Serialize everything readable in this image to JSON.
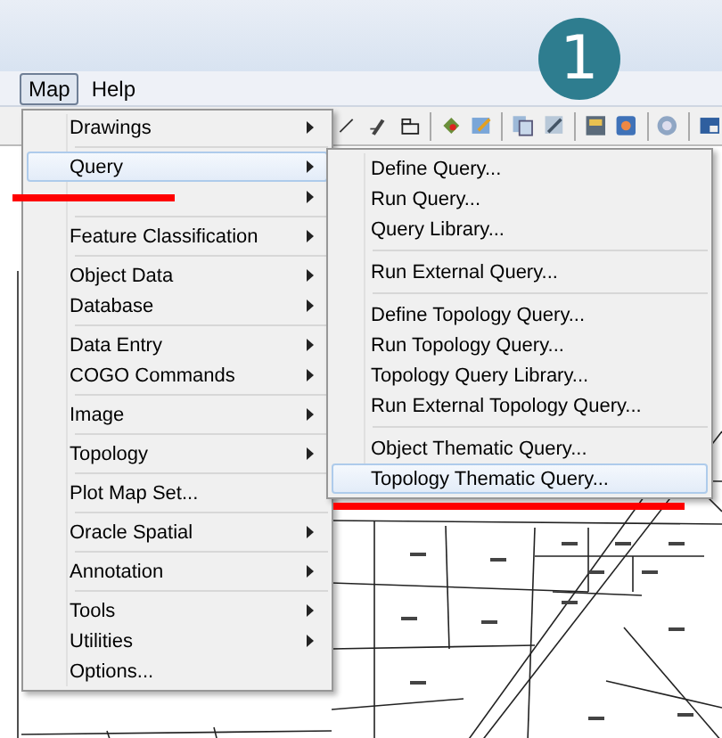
{
  "badge": "1",
  "menubar": [
    {
      "label": "Map",
      "selected": true
    },
    {
      "label": "Help",
      "selected": false
    }
  ],
  "menu": {
    "items": [
      {
        "kind": "item",
        "label": "Drawings",
        "submenu": true,
        "selected": false
      },
      {
        "kind": "separator"
      },
      {
        "kind": "item",
        "label": "Query",
        "submenu": true,
        "selected": true
      },
      {
        "kind": "item",
        "submenu": true,
        "selected": false,
        "struck": true
      },
      {
        "kind": "separator"
      },
      {
        "kind": "item",
        "label": "Feature Classification",
        "submenu": true,
        "selected": false
      },
      {
        "kind": "separator"
      },
      {
        "kind": "item",
        "label": "Object Data",
        "submenu": true,
        "selected": false
      },
      {
        "kind": "item",
        "label": "Database",
        "submenu": true,
        "selected": false
      },
      {
        "kind": "separator"
      },
      {
        "kind": "item",
        "label": "Data Entry",
        "submenu": true,
        "selected": false
      },
      {
        "kind": "item",
        "label": "COGO Commands",
        "submenu": true,
        "selected": false
      },
      {
        "kind": "separator"
      },
      {
        "kind": "item",
        "label": "Image",
        "submenu": true,
        "selected": false
      },
      {
        "kind": "separator"
      },
      {
        "kind": "item",
        "label": "Topology",
        "submenu": true,
        "selected": false
      },
      {
        "kind": "separator"
      },
      {
        "kind": "item",
        "label": "Plot Map Set...",
        "submenu": false,
        "selected": false
      },
      {
        "kind": "separator"
      },
      {
        "kind": "item",
        "label": "Oracle Spatial",
        "submenu": true,
        "selected": false
      },
      {
        "kind": "separator"
      },
      {
        "kind": "item",
        "label": "Annotation",
        "submenu": true,
        "selected": false
      },
      {
        "kind": "separator"
      },
      {
        "kind": "item",
        "label": "Tools",
        "submenu": true,
        "selected": false
      },
      {
        "kind": "item",
        "label": "Utilities",
        "submenu": true,
        "selected": false
      },
      {
        "kind": "item",
        "label": "Options...",
        "submenu": false,
        "selected": false
      }
    ]
  },
  "submenu": {
    "items": [
      {
        "kind": "item",
        "label": "Define Query...",
        "selected": false
      },
      {
        "kind": "item",
        "label": "Run Query...",
        "selected": false
      },
      {
        "kind": "item",
        "label": "Query Library...",
        "selected": false
      },
      {
        "kind": "separator"
      },
      {
        "kind": "item",
        "label": "Run External Query...",
        "selected": false
      },
      {
        "kind": "separator"
      },
      {
        "kind": "item",
        "label": "Define Topology Query...",
        "selected": false
      },
      {
        "kind": "item",
        "label": "Run Topology Query...",
        "selected": false
      },
      {
        "kind": "item",
        "label": "Topology Query Library...",
        "selected": false
      },
      {
        "kind": "item",
        "label": "Run External Topology Query...",
        "selected": false
      },
      {
        "kind": "separator"
      },
      {
        "kind": "item",
        "label": "Object Thematic Query...",
        "selected": false
      },
      {
        "kind": "item",
        "label": "Topology Thematic Query...",
        "selected": true,
        "underlined": true
      }
    ]
  }
}
